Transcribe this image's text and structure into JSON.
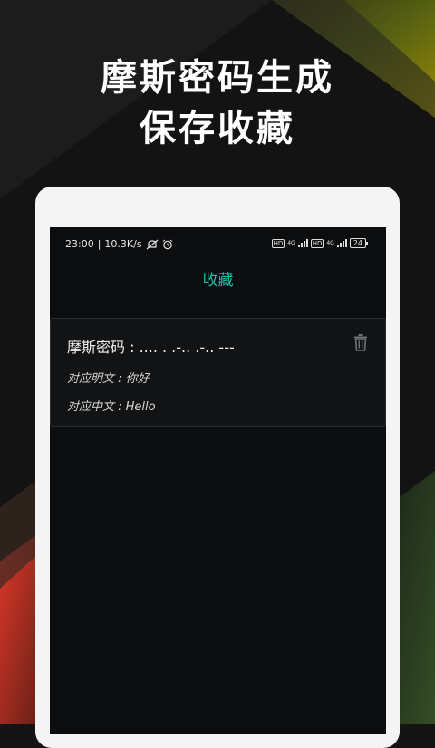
{
  "promo": {
    "line1": "摩斯密码生成",
    "line2": "保存收藏"
  },
  "statusbar": {
    "time": "23:00",
    "separator": "|",
    "speed": "10.3K/s",
    "hd1": "HD",
    "net1": "4G",
    "hd2": "HD",
    "net2": "4G",
    "battery": "24"
  },
  "screen_title": "收藏",
  "favorites": [
    {
      "morse_label": "摩斯密码 : ",
      "morse_value": ".... . .-.. .-.. ---",
      "plain_label": "对应明文 : ",
      "plain_value": "你好",
      "cn_label": "对应中文 : ",
      "cn_value": "Hello"
    }
  ],
  "colors": {
    "accent": "#1fc0b0",
    "background": "#141414",
    "screen": "#0c0d0f",
    "phone_frame": "#f4f4f4"
  },
  "icons": {
    "delete": "trash-icon",
    "alarm": "alarm-clock-icon",
    "mute": "bell-off-icon"
  }
}
